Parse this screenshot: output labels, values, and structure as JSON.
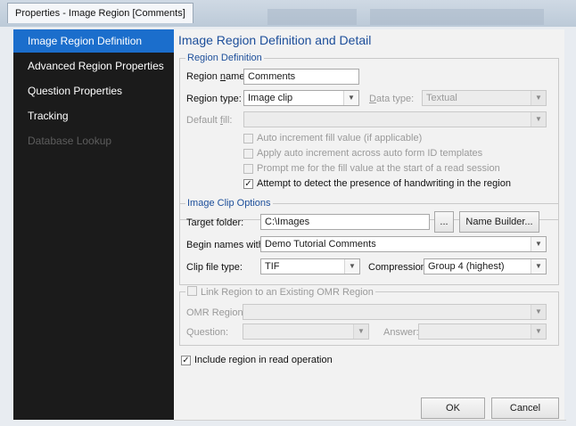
{
  "window": {
    "title": "Properties - Image Region [Comments]"
  },
  "sidebar": {
    "items": [
      {
        "label": "Image Region Definition"
      },
      {
        "label": "Advanced Region Properties"
      },
      {
        "label": "Question Properties"
      },
      {
        "label": "Tracking"
      },
      {
        "label": "Database Lookup"
      }
    ]
  },
  "main": {
    "heading": "Image Region Definition and Detail"
  },
  "region_definition": {
    "legend": "Region Definition",
    "name_label_a": "Region ",
    "name_label_u": "n",
    "name_label_b": "ame:",
    "name_value": "Comments",
    "type_label": "Region type:",
    "type_value": "Image clip",
    "data_type_label_u": "D",
    "data_type_label_b": "ata type:",
    "data_type_value": "Textual",
    "default_fill_a": "Default ",
    "default_fill_u": "f",
    "default_fill_b": "ill:",
    "default_fill_value": "",
    "checks": [
      {
        "label": "Auto increment fill value (if applicable)",
        "checked": false
      },
      {
        "label": "Apply auto increment across auto form ID templates",
        "checked": false
      },
      {
        "label": "Prompt me for the fill value at the start of a read session",
        "checked": false
      },
      {
        "label": "Attempt to detect the presence of handwriting in the region",
        "checked": true
      }
    ]
  },
  "image_clip": {
    "legend": "Image Clip Options",
    "target_folder_label": "Target folder:",
    "target_folder_value": "C:\\Images",
    "browse_label": "...",
    "name_builder_label": "Name Builder...",
    "begin_names_label": "Begin names with:",
    "begin_names_value": "Demo Tutorial Comments",
    "clip_file_type_label": "Clip file type:",
    "clip_file_type_value": "TIF",
    "compression_label": "Compression:",
    "compression_value": "Group 4 (highest)"
  },
  "omr": {
    "legend": "Link Region to an Existing OMR Region",
    "linked": false,
    "omr_region_label": "OMR Region:",
    "question_label": "Question:",
    "answer_label": "Answer:"
  },
  "include": {
    "label": "Include region in read operation",
    "checked": true
  },
  "buttons": {
    "ok": "OK",
    "cancel": "Cancel"
  },
  "icons": {
    "dropdown": "chevron-down-icon",
    "check": "checkmark-icon"
  }
}
